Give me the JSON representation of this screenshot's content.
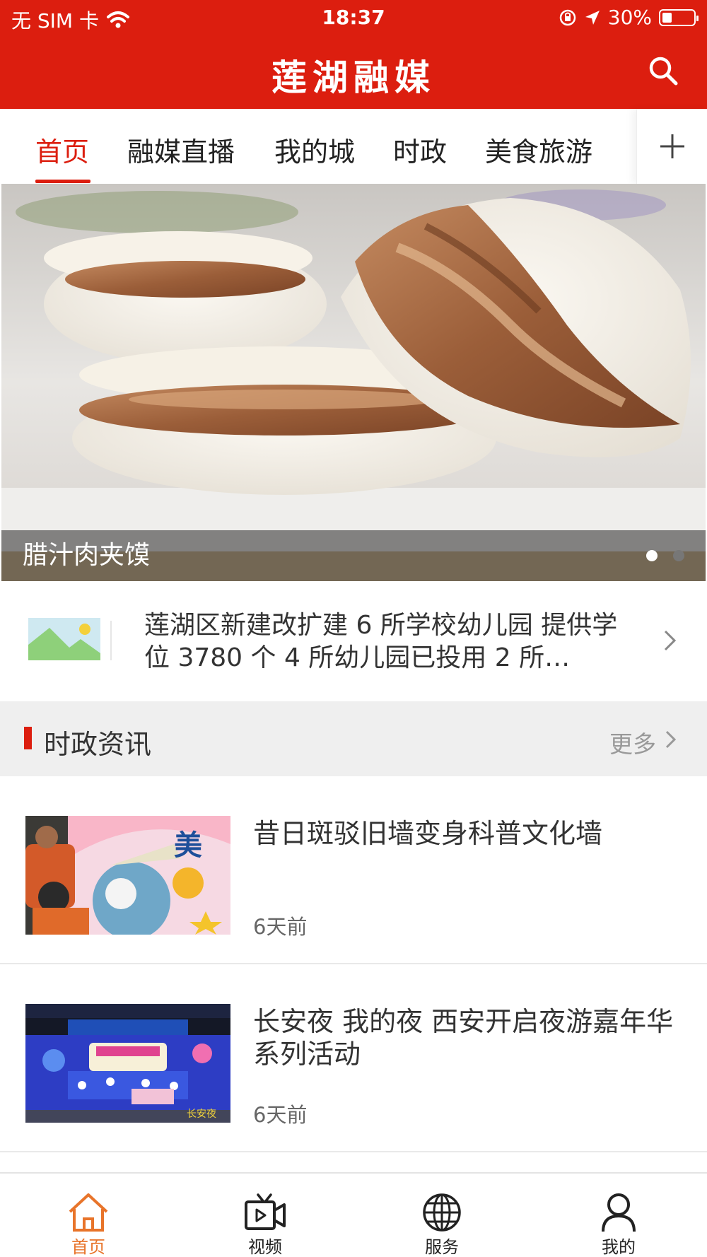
{
  "status_bar": {
    "carrier": "无 SIM 卡",
    "time": "18:37",
    "battery": "30%",
    "battery_level": 0.3
  },
  "header": {
    "title": "莲湖融媒",
    "search_icon": "search-icon"
  },
  "tabs": {
    "items": [
      {
        "label": "首页",
        "active": true
      },
      {
        "label": "融媒直播",
        "active": false
      },
      {
        "label": "我的城",
        "active": false
      },
      {
        "label": "时政",
        "active": false
      },
      {
        "label": "美食旅游",
        "active": false
      }
    ],
    "add_icon": "plus-icon"
  },
  "banner": {
    "caption": "腊汁肉夹馍",
    "slide_count": 2,
    "current_slide": 1
  },
  "headline": {
    "title": "莲湖区新建改扩建 6 所学校幼儿园 提供学位 3780 个 4 所幼儿园已投用 2 所…",
    "thumb_icon": "image-placeholder-icon"
  },
  "section": {
    "title": "时政资讯",
    "more": "更多"
  },
  "news": [
    {
      "title": "昔日斑驳旧墙变身科普文化墙",
      "time": "6天前"
    },
    {
      "title": "长安夜 我的夜 西安开启夜游嘉年华系列活动",
      "time": "6天前"
    }
  ],
  "bottom_nav": [
    {
      "label": "首页",
      "icon": "home-icon",
      "active": true
    },
    {
      "label": "视频",
      "icon": "video-icon",
      "active": false
    },
    {
      "label": "服务",
      "icon": "globe-icon",
      "active": false
    },
    {
      "label": "我的",
      "icon": "user-icon",
      "active": false
    }
  ],
  "colors": {
    "brand_red": "#dc1e0f",
    "active_nav": "#e8742a"
  }
}
